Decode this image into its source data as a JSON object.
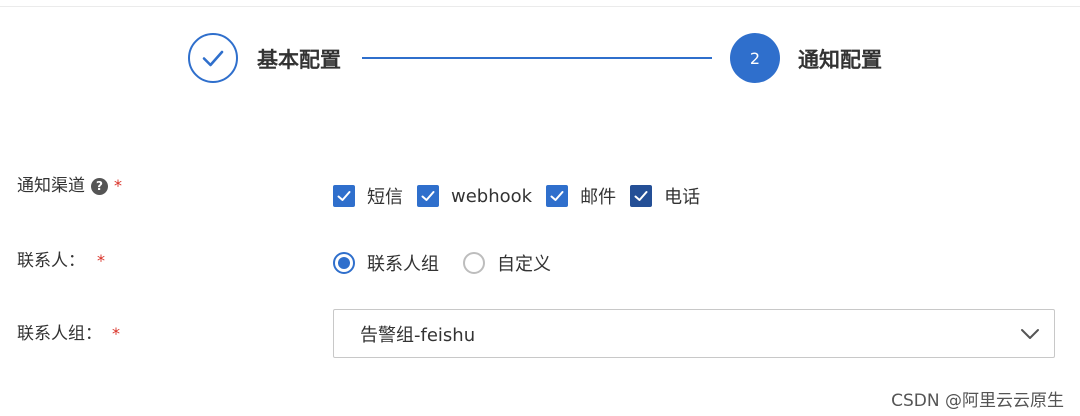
{
  "steps": {
    "step1": {
      "label": "基本配置",
      "status": "done"
    },
    "step2": {
      "number": "2",
      "label": "通知配置",
      "status": "active"
    }
  },
  "form": {
    "channel": {
      "label": "通知渠道",
      "required_mark": "*",
      "help": "?",
      "options": [
        {
          "label": "短信",
          "checked": true
        },
        {
          "label": "webhook",
          "checked": true
        },
        {
          "label": "邮件",
          "checked": true
        },
        {
          "label": "电话",
          "checked": true
        }
      ]
    },
    "contact": {
      "label": "联系人：",
      "required_mark": "*",
      "options": [
        {
          "label": "联系人组",
          "selected": true
        },
        {
          "label": "自定义",
          "selected": false
        }
      ]
    },
    "contact_group": {
      "label": "联系人组：",
      "required_mark": "*",
      "value": "告警组-feishu"
    }
  },
  "watermark": "CSDN @阿里云云原生",
  "colors": {
    "primary": "#2f6fcc",
    "required": "#d93026",
    "border": "#c8c8c8"
  }
}
